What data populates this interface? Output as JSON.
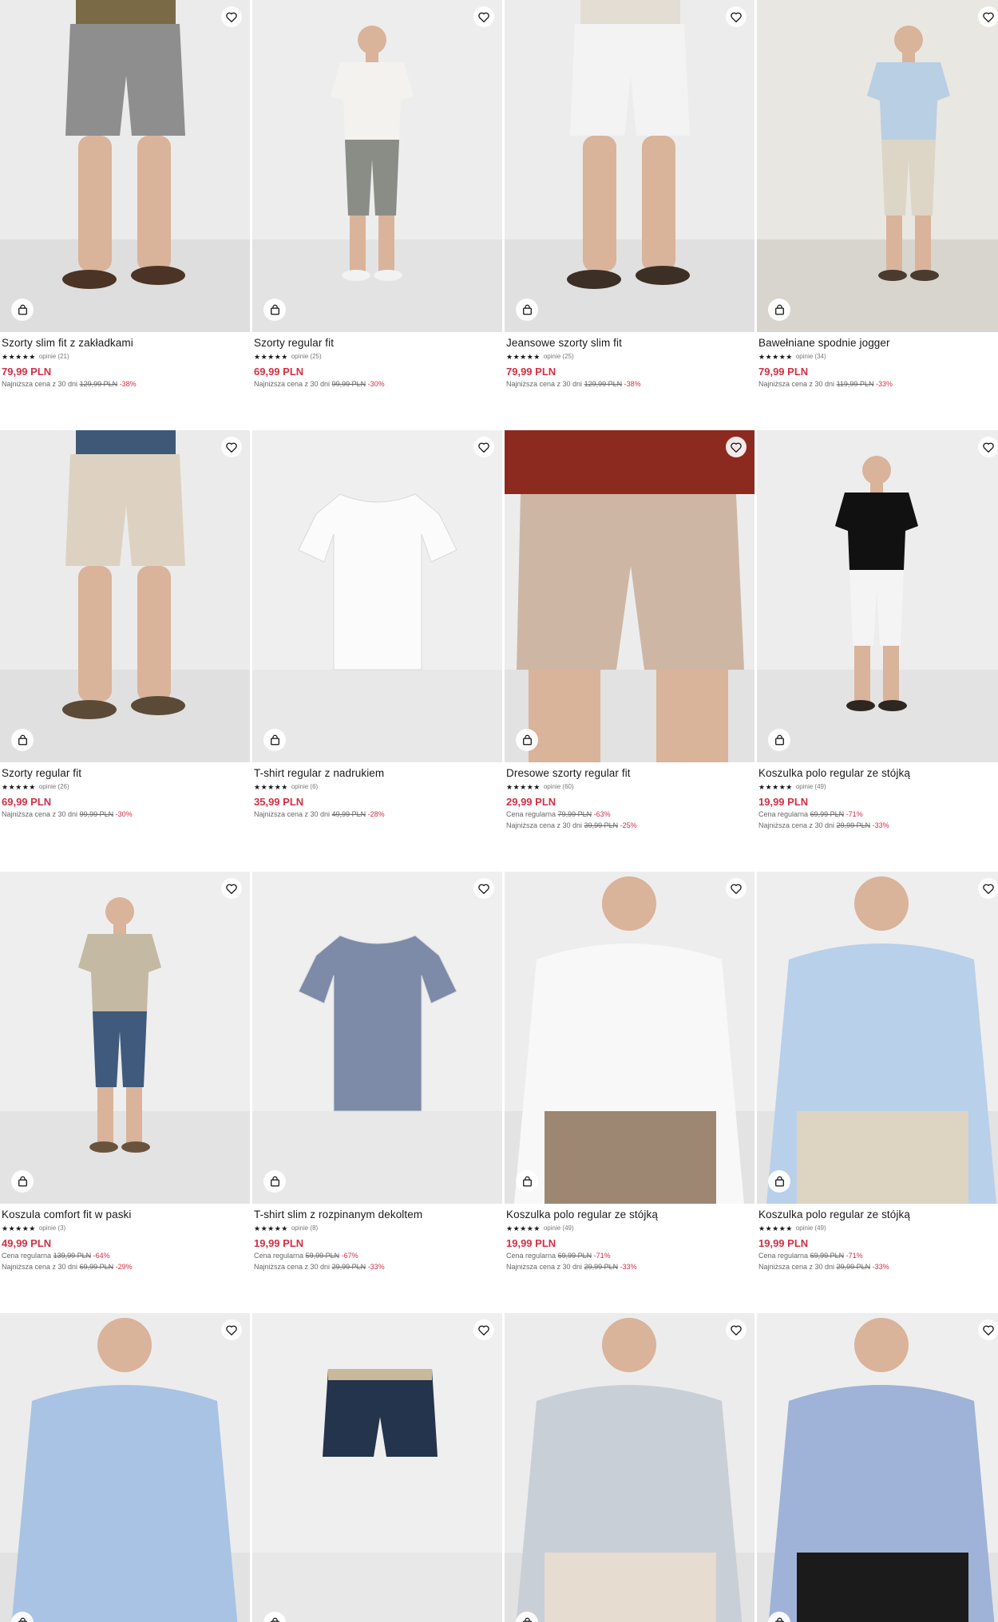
{
  "icons": {
    "favorite": "heart-icon",
    "cart": "shopping-bag-icon"
  },
  "colors": {
    "price": "#d32f45",
    "star": "#1a1a1a",
    "text": "#1a1a1a",
    "photo_bg": "#eeeeee"
  },
  "products": [
    {
      "name": "Szorty slim fit z zakładkami",
      "stars": "★★★★★",
      "reviews": "opinie (21)",
      "price": "79,99 PLN",
      "lowest": {
        "label": "Najniższa cena z 30 dni",
        "old": "129,99 PLN",
        "discount": "-38%"
      }
    },
    {
      "name": "Szorty regular fit",
      "stars": "★★★★★",
      "reviews": "opinie (25)",
      "price": "69,99 PLN",
      "lowest": {
        "label": "Najniższa cena z 30 dni",
        "old": "99,99 PLN",
        "discount": "-30%"
      }
    },
    {
      "name": "Jeansowe szorty slim fit",
      "stars": "★★★★★",
      "reviews": "opinie (25)",
      "price": "79,99 PLN",
      "lowest": {
        "label": "Najniższa cena z 30 dni",
        "old": "129,99 PLN",
        "discount": "-38%"
      }
    },
    {
      "name": "Bawełniane spodnie jogger",
      "stars": "★★★★★",
      "reviews": "opinie (34)",
      "price": "79,99 PLN",
      "lowest": {
        "label": "Najniższa cena z 30 dni",
        "old": "119,99 PLN",
        "discount": "-33%"
      }
    },
    {
      "name": "Szorty regular fit",
      "stars": "★★★★★",
      "reviews": "opinie (26)",
      "price": "69,99 PLN",
      "lowest": {
        "label": "Najniższa cena z 30 dni",
        "old": "99,99 PLN",
        "discount": "-30%"
      }
    },
    {
      "name": "T-shirt regular z nadrukiem",
      "stars": "★★★★★",
      "reviews": "opinie (6)",
      "price": "35,99 PLN",
      "lowest": {
        "label": "Najniższa cena z 30 dni",
        "old": "49,99 PLN",
        "discount": "-28%"
      }
    },
    {
      "name": "Dresowe szorty regular fit",
      "stars": "★★★★★",
      "reviews": "opinie (60)",
      "price": "29,99 PLN",
      "regular": {
        "label": "Cena regularna",
        "old": "79,99 PLN",
        "discount": "-63%"
      },
      "lowest": {
        "label": "Najniższa cena z 30 dni",
        "old": "39,99 PLN",
        "discount": "-25%"
      }
    },
    {
      "name": "Koszulka polo regular ze stójką",
      "stars": "★★★★★",
      "reviews": "opinie (49)",
      "price": "19,99 PLN",
      "regular": {
        "label": "Cena regularna",
        "old": "69,99 PLN",
        "discount": "-71%"
      },
      "lowest": {
        "label": "Najniższa cena z 30 dni",
        "old": "29,99 PLN",
        "discount": "-33%"
      }
    },
    {
      "name": "Koszula comfort fit w paski",
      "stars": "★★★★★",
      "reviews": "opinie (3)",
      "price": "49,99 PLN",
      "regular": {
        "label": "Cena regularna",
        "old": "139,99 PLN",
        "discount": "-64%"
      },
      "lowest": {
        "label": "Najniższa cena z 30 dni",
        "old": "69,99 PLN",
        "discount": "-29%"
      }
    },
    {
      "name": "T-shirt slim z rozpinanym dekoltem",
      "stars": "★★★★★",
      "reviews": "opinie (8)",
      "price": "19,99 PLN",
      "regular": {
        "label": "Cena regularna",
        "old": "59,99 PLN",
        "discount": "-67%"
      },
      "lowest": {
        "label": "Najniższa cena z 30 dni",
        "old": "29,99 PLN",
        "discount": "-33%"
      }
    },
    {
      "name": "Koszulka polo regular ze stójką",
      "stars": "★★★★★",
      "reviews": "opinie (49)",
      "price": "19,99 PLN",
      "regular": {
        "label": "Cena regularna",
        "old": "69,99 PLN",
        "discount": "-71%"
      },
      "lowest": {
        "label": "Najniższa cena z 30 dni",
        "old": "29,99 PLN",
        "discount": "-33%"
      }
    },
    {
      "name": "Koszulka polo regular ze stójką",
      "stars": "★★★★★",
      "reviews": "opinie (49)",
      "price": "19,99 PLN",
      "regular": {
        "label": "Cena regularna",
        "old": "69,99 PLN",
        "discount": "-71%"
      },
      "lowest": {
        "label": "Najniższa cena z 30 dni",
        "old": "29,99 PLN",
        "discount": "-33%"
      }
    },
    {
      "name": "",
      "stars": "",
      "reviews": "",
      "price": ""
    },
    {
      "name": "",
      "stars": "",
      "reviews": "",
      "price": ""
    },
    {
      "name": "",
      "stars": "",
      "reviews": "",
      "price": ""
    },
    {
      "name": "",
      "stars": "",
      "reviews": "",
      "price": ""
    }
  ]
}
